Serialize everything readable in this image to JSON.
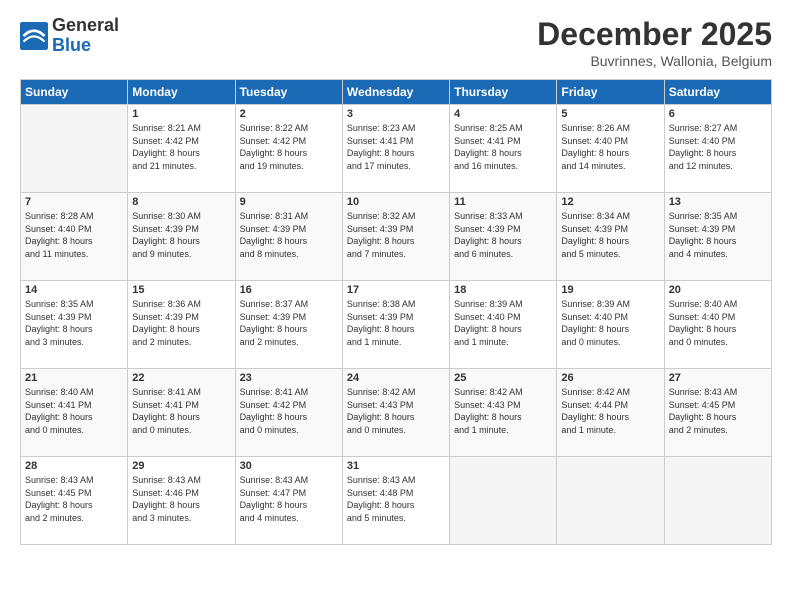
{
  "logo": {
    "general": "General",
    "blue": "Blue"
  },
  "header": {
    "title": "December 2025",
    "subtitle": "Buvrinnes, Wallonia, Belgium"
  },
  "days_of_week": [
    "Sunday",
    "Monday",
    "Tuesday",
    "Wednesday",
    "Thursday",
    "Friday",
    "Saturday"
  ],
  "weeks": [
    [
      {
        "day": "",
        "info": ""
      },
      {
        "day": "1",
        "info": "Sunrise: 8:21 AM\nSunset: 4:42 PM\nDaylight: 8 hours\nand 21 minutes."
      },
      {
        "day": "2",
        "info": "Sunrise: 8:22 AM\nSunset: 4:42 PM\nDaylight: 8 hours\nand 19 minutes."
      },
      {
        "day": "3",
        "info": "Sunrise: 8:23 AM\nSunset: 4:41 PM\nDaylight: 8 hours\nand 17 minutes."
      },
      {
        "day": "4",
        "info": "Sunrise: 8:25 AM\nSunset: 4:41 PM\nDaylight: 8 hours\nand 16 minutes."
      },
      {
        "day": "5",
        "info": "Sunrise: 8:26 AM\nSunset: 4:40 PM\nDaylight: 8 hours\nand 14 minutes."
      },
      {
        "day": "6",
        "info": "Sunrise: 8:27 AM\nSunset: 4:40 PM\nDaylight: 8 hours\nand 12 minutes."
      }
    ],
    [
      {
        "day": "7",
        "info": "Sunrise: 8:28 AM\nSunset: 4:40 PM\nDaylight: 8 hours\nand 11 minutes."
      },
      {
        "day": "8",
        "info": "Sunrise: 8:30 AM\nSunset: 4:39 PM\nDaylight: 8 hours\nand 9 minutes."
      },
      {
        "day": "9",
        "info": "Sunrise: 8:31 AM\nSunset: 4:39 PM\nDaylight: 8 hours\nand 8 minutes."
      },
      {
        "day": "10",
        "info": "Sunrise: 8:32 AM\nSunset: 4:39 PM\nDaylight: 8 hours\nand 7 minutes."
      },
      {
        "day": "11",
        "info": "Sunrise: 8:33 AM\nSunset: 4:39 PM\nDaylight: 8 hours\nand 6 minutes."
      },
      {
        "day": "12",
        "info": "Sunrise: 8:34 AM\nSunset: 4:39 PM\nDaylight: 8 hours\nand 5 minutes."
      },
      {
        "day": "13",
        "info": "Sunrise: 8:35 AM\nSunset: 4:39 PM\nDaylight: 8 hours\nand 4 minutes."
      }
    ],
    [
      {
        "day": "14",
        "info": "Sunrise: 8:35 AM\nSunset: 4:39 PM\nDaylight: 8 hours\nand 3 minutes."
      },
      {
        "day": "15",
        "info": "Sunrise: 8:36 AM\nSunset: 4:39 PM\nDaylight: 8 hours\nand 2 minutes."
      },
      {
        "day": "16",
        "info": "Sunrise: 8:37 AM\nSunset: 4:39 PM\nDaylight: 8 hours\nand 2 minutes."
      },
      {
        "day": "17",
        "info": "Sunrise: 8:38 AM\nSunset: 4:39 PM\nDaylight: 8 hours\nand 1 minute."
      },
      {
        "day": "18",
        "info": "Sunrise: 8:39 AM\nSunset: 4:40 PM\nDaylight: 8 hours\nand 1 minute."
      },
      {
        "day": "19",
        "info": "Sunrise: 8:39 AM\nSunset: 4:40 PM\nDaylight: 8 hours\nand 0 minutes."
      },
      {
        "day": "20",
        "info": "Sunrise: 8:40 AM\nSunset: 4:40 PM\nDaylight: 8 hours\nand 0 minutes."
      }
    ],
    [
      {
        "day": "21",
        "info": "Sunrise: 8:40 AM\nSunset: 4:41 PM\nDaylight: 8 hours\nand 0 minutes."
      },
      {
        "day": "22",
        "info": "Sunrise: 8:41 AM\nSunset: 4:41 PM\nDaylight: 8 hours\nand 0 minutes."
      },
      {
        "day": "23",
        "info": "Sunrise: 8:41 AM\nSunset: 4:42 PM\nDaylight: 8 hours\nand 0 minutes."
      },
      {
        "day": "24",
        "info": "Sunrise: 8:42 AM\nSunset: 4:43 PM\nDaylight: 8 hours\nand 0 minutes."
      },
      {
        "day": "25",
        "info": "Sunrise: 8:42 AM\nSunset: 4:43 PM\nDaylight: 8 hours\nand 1 minute."
      },
      {
        "day": "26",
        "info": "Sunrise: 8:42 AM\nSunset: 4:44 PM\nDaylight: 8 hours\nand 1 minute."
      },
      {
        "day": "27",
        "info": "Sunrise: 8:43 AM\nSunset: 4:45 PM\nDaylight: 8 hours\nand 2 minutes."
      }
    ],
    [
      {
        "day": "28",
        "info": "Sunrise: 8:43 AM\nSunset: 4:45 PM\nDaylight: 8 hours\nand 2 minutes."
      },
      {
        "day": "29",
        "info": "Sunrise: 8:43 AM\nSunset: 4:46 PM\nDaylight: 8 hours\nand 3 minutes."
      },
      {
        "day": "30",
        "info": "Sunrise: 8:43 AM\nSunset: 4:47 PM\nDaylight: 8 hours\nand 4 minutes."
      },
      {
        "day": "31",
        "info": "Sunrise: 8:43 AM\nSunset: 4:48 PM\nDaylight: 8 hours\nand 5 minutes."
      },
      {
        "day": "",
        "info": ""
      },
      {
        "day": "",
        "info": ""
      },
      {
        "day": "",
        "info": ""
      }
    ]
  ]
}
